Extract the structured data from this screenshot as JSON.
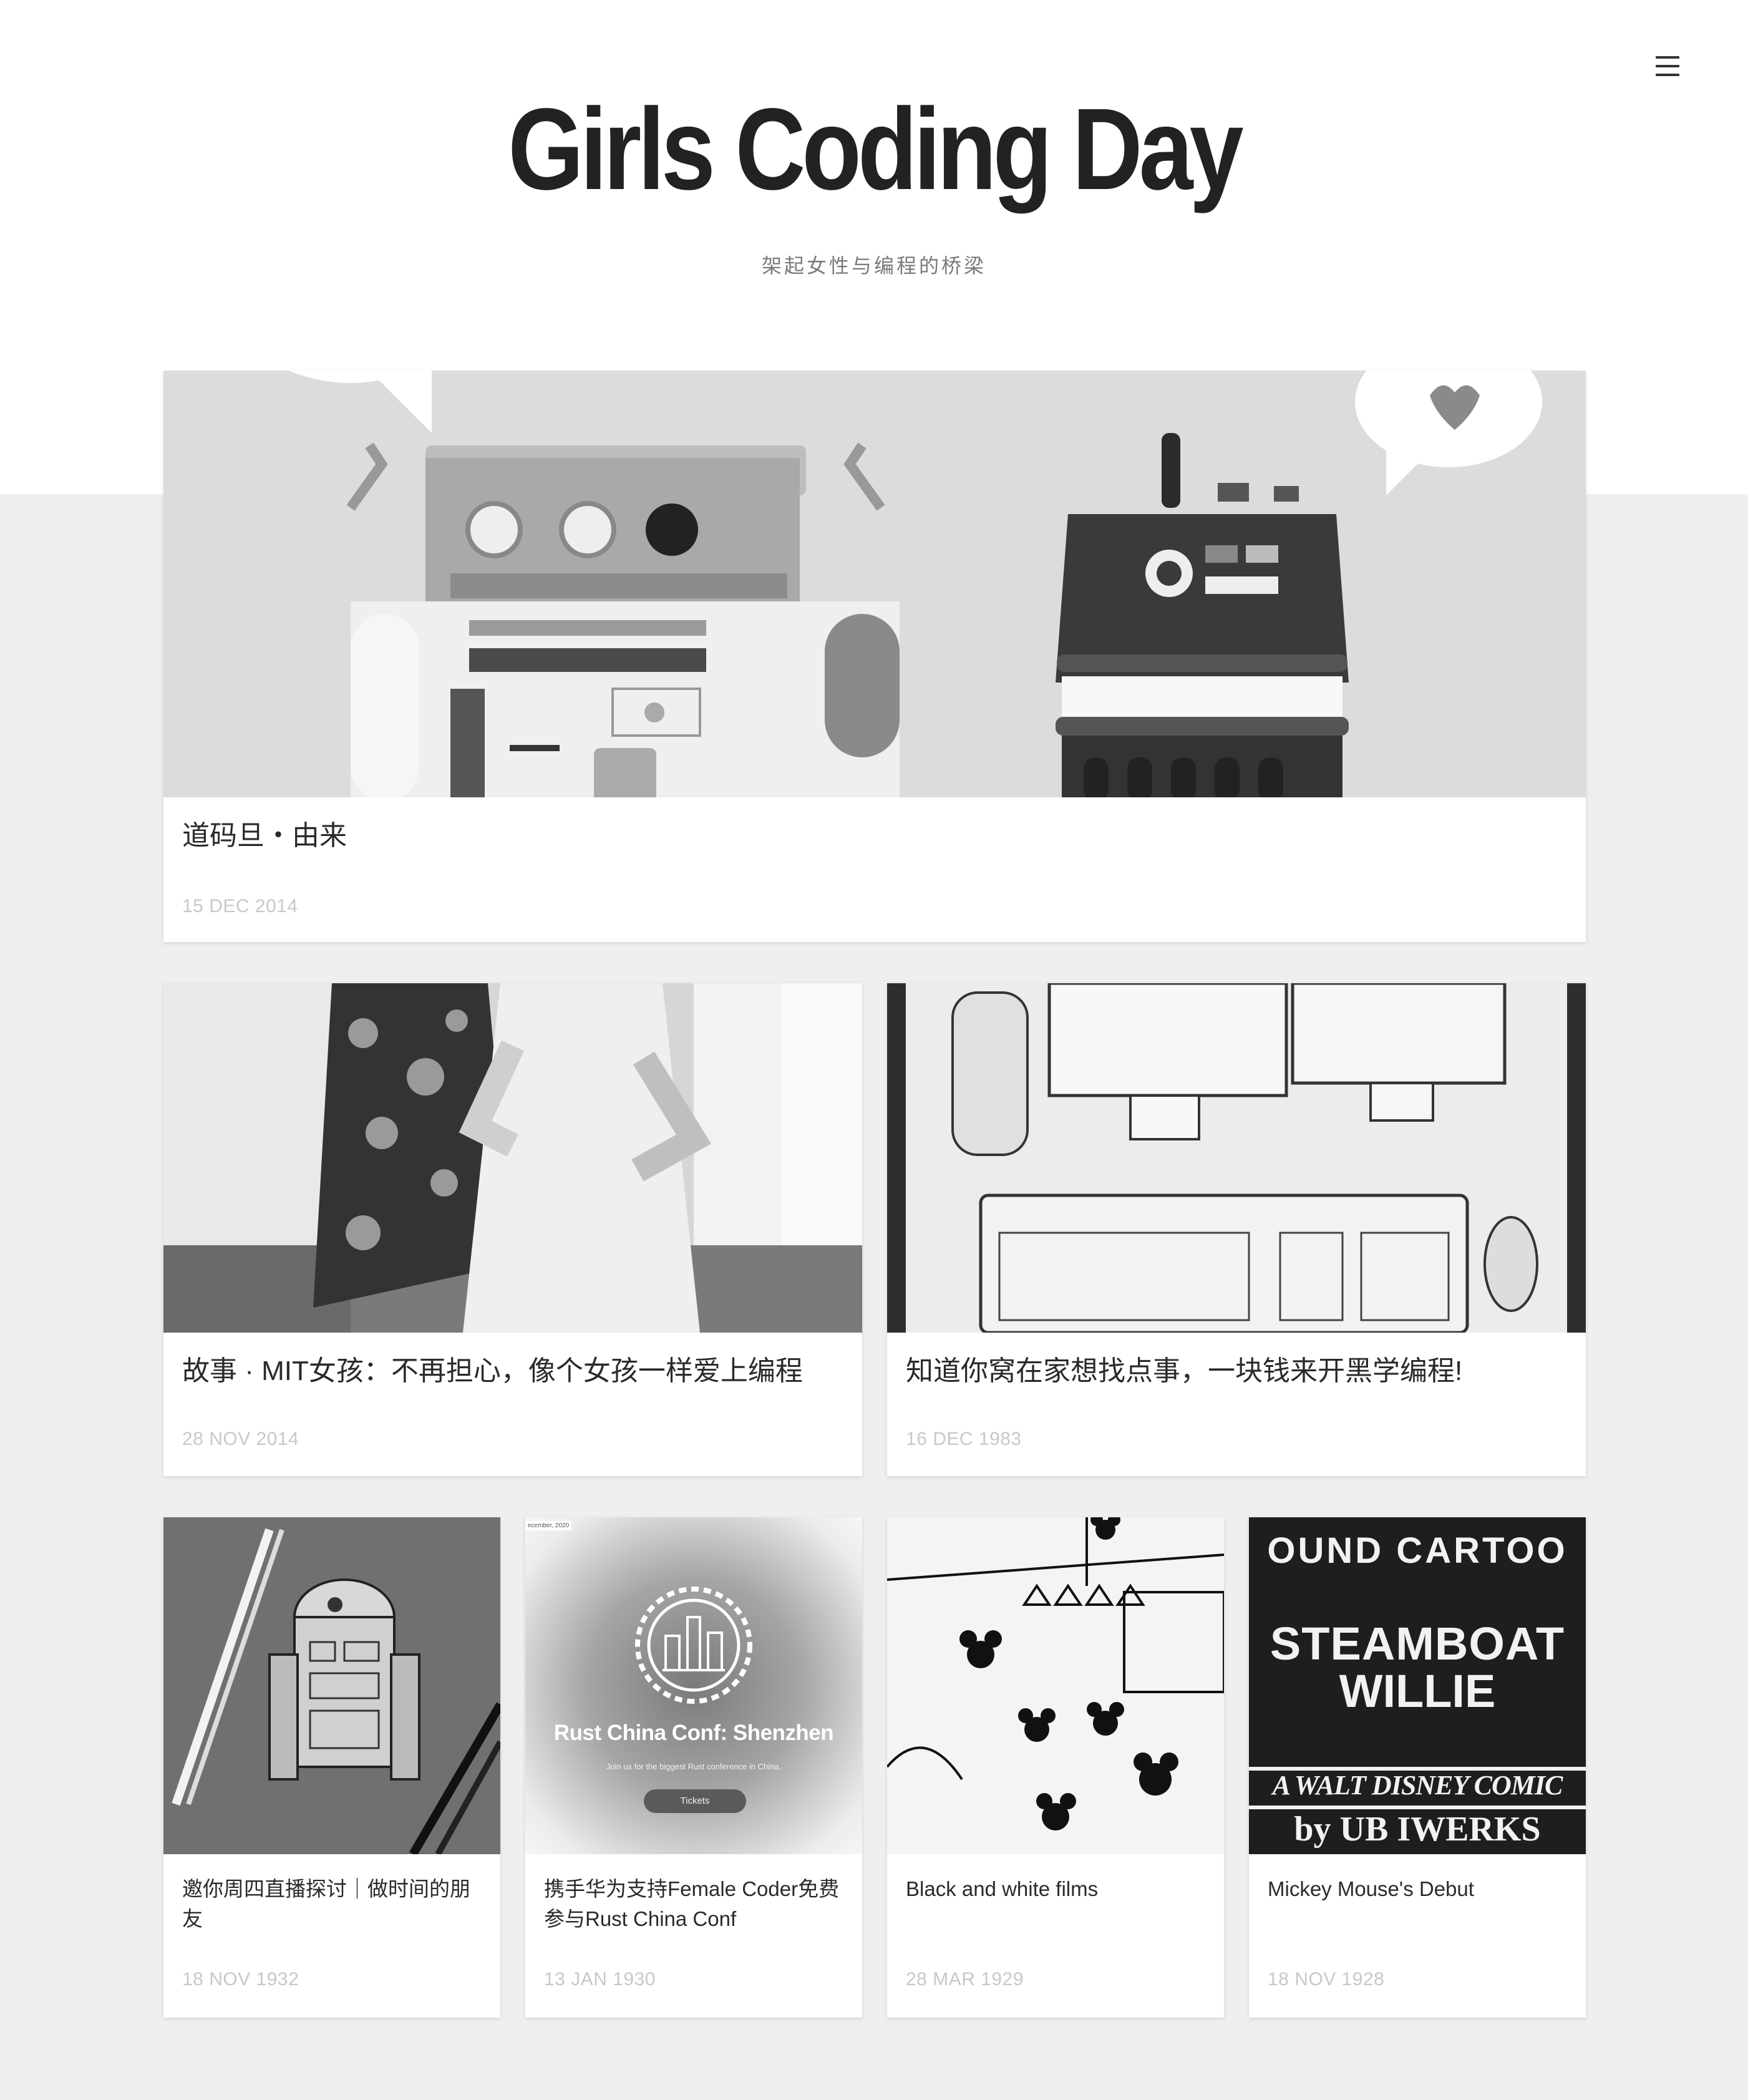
{
  "site": {
    "title": "Girls Coding Day",
    "subtitle": "架起女性与编程的桥梁",
    "menu_icon": "hamburger-menu-icon"
  },
  "posts": [
    {
      "title": "道码旦・由来",
      "date": "15 DEC 2014",
      "image": "robots-illustration"
    },
    {
      "title": "故事 · MIT女孩：不再担心，像个女孩一样爱上编程",
      "date": "28 NOV 2014",
      "image": "two-girls-photo"
    },
    {
      "title": "知道你窝在家想找点事，一块钱来开黑学编程!",
      "date": "16 DEC 1983",
      "image": "computer-drawing"
    },
    {
      "title": "邀你周四直播探讨｜做时间的朋友",
      "date": "18 NOV 1932",
      "image": "r2d2-sketch"
    },
    {
      "title": "携手华为支持Female Coder免费参与Rust China Conf",
      "date": "13 JAN 1930",
      "image": "rust-china-conf-banner",
      "banner": {
        "corner": "ecember, 2020",
        "heading": "Rust China Conf: Shenzhen",
        "tagline": "Join us for the biggest Rust conference in China.",
        "button": "Tickets"
      }
    },
    {
      "title": "Black and white films",
      "date": "28 MAR 1929",
      "image": "mickey-cartoon-still"
    },
    {
      "title": "Mickey Mouse's Debut",
      "date": "18 NOV 1928",
      "image": "steamboat-willie-title-card",
      "poster": {
        "line1": "OUND CARTOO",
        "line2": "STEAMBOAT",
        "line3": "WILLIE",
        "line4": "A WALT DISNEY COMIC",
        "line5": "by UB IWERKS"
      }
    }
  ]
}
